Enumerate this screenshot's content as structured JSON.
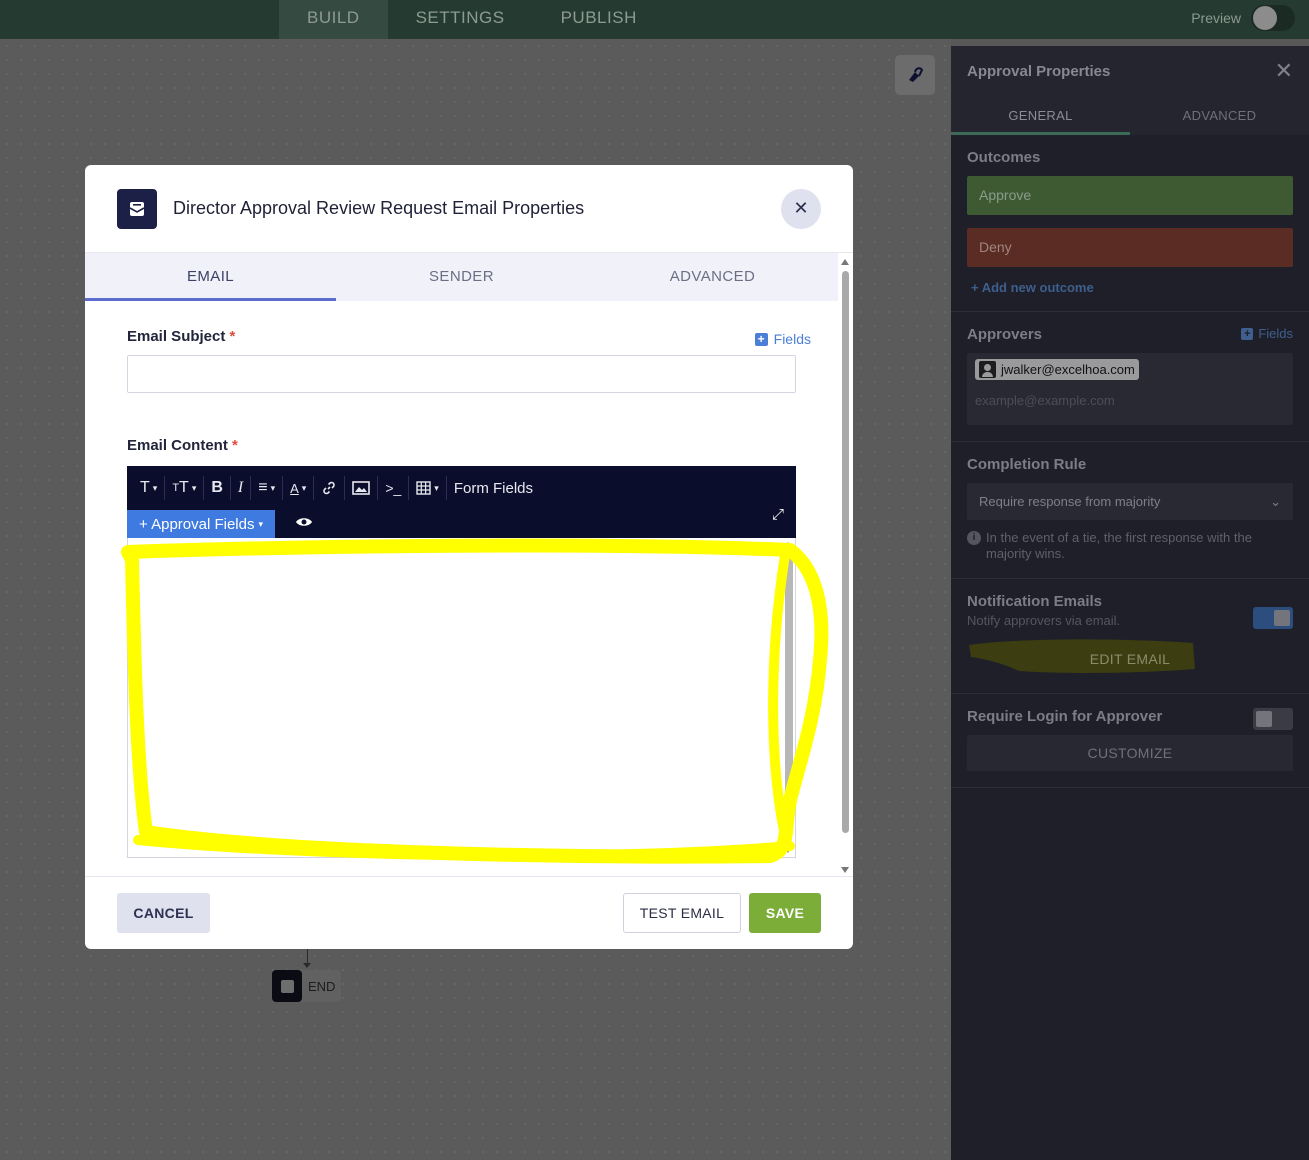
{
  "topbar": {
    "tabs": [
      "BUILD",
      "SETTINGS",
      "PUBLISH"
    ],
    "active_tab": "BUILD",
    "preview_label": "Preview"
  },
  "canvas": {
    "end_node_label": "END"
  },
  "right_panel": {
    "title": "Approval Properties",
    "tabs": [
      "GENERAL",
      "ADVANCED"
    ],
    "outcomes": {
      "heading": "Outcomes",
      "items": [
        "Approve",
        "Deny"
      ],
      "add_label": "+ Add new outcome"
    },
    "approvers": {
      "heading": "Approvers",
      "fields_label": "Fields",
      "chip": "jwalker@excelhoa.com",
      "placeholder": "example@example.com"
    },
    "completion_rule": {
      "heading": "Completion Rule",
      "selected": "Require response from majority",
      "note": "In the event of a tie, the first response with the majority wins."
    },
    "notification_emails": {
      "heading": "Notification Emails",
      "sub": "Notify approvers via email.",
      "enabled": true,
      "button": "EDIT EMAIL"
    },
    "require_login": {
      "heading": "Require Login for Approver",
      "enabled": false,
      "button": "CUSTOMIZE"
    }
  },
  "modal": {
    "title": "Director Approval Review Request Email Properties",
    "tabs": [
      "EMAIL",
      "SENDER",
      "ADVANCED"
    ],
    "active_tab": "EMAIL",
    "email_subject_label": "Email Subject",
    "required_mark": "*",
    "fields_label": "Fields",
    "subject_value": "",
    "email_content_label": "Email Content",
    "toolbar": {
      "form_fields": "Form Fields",
      "approval_fields": "+ Approval Fields"
    },
    "buttons": {
      "cancel": "CANCEL",
      "test_email": "TEST EMAIL",
      "save": "SAVE"
    }
  },
  "colors": {
    "highlight": "#ffff00",
    "save_green": "#7cad39",
    "accent_blue": "#3e7ae0",
    "topbar_green": "#253b31"
  }
}
